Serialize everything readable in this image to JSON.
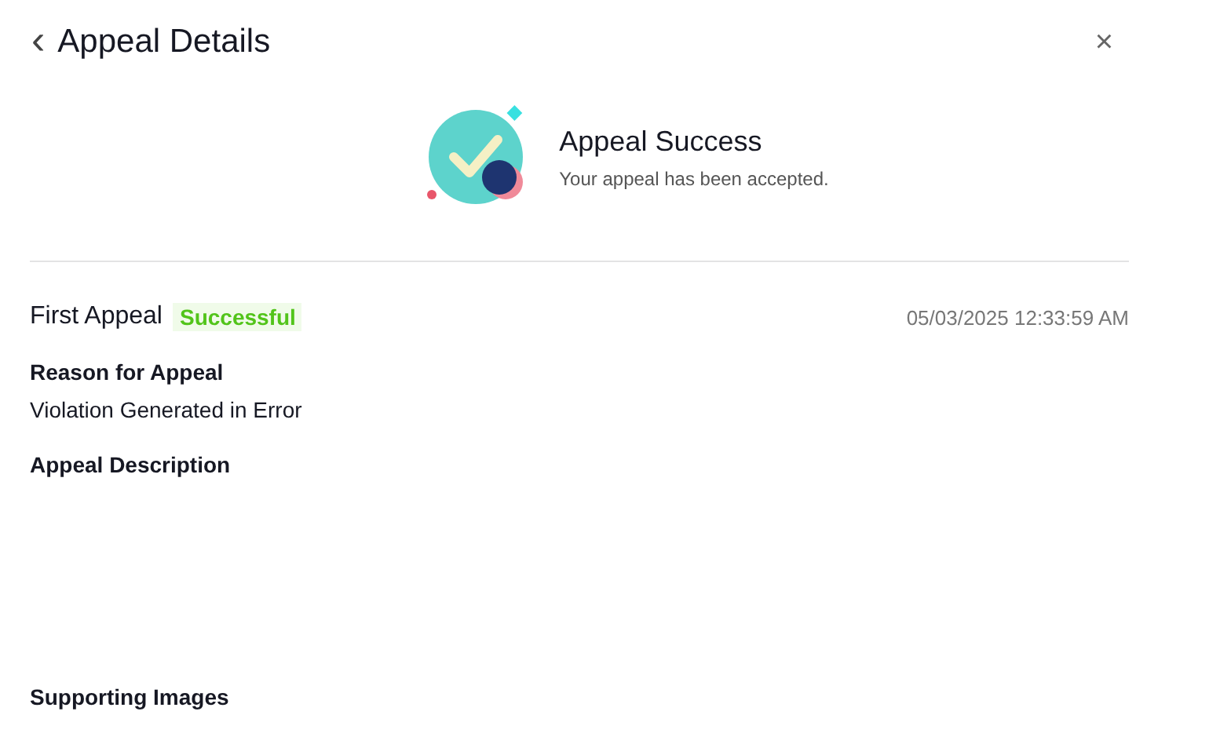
{
  "header": {
    "back": "‹",
    "title": "Appeal Details",
    "close": "×"
  },
  "banner": {
    "title": "Appeal Success",
    "subtitle": "Your appeal has been accepted."
  },
  "appeal": {
    "title": "First Appeal",
    "status": {
      "label": "Successful",
      "kind": "success"
    },
    "time": "05/03/2025 12:33:59 AM",
    "fields": [
      {
        "label": "Reason for Appeal",
        "value": "Violation Generated in Error"
      },
      {
        "label": "Appeal Description",
        "kind": "redacted"
      }
    ],
    "images_label": "Supporting Images"
  }
}
